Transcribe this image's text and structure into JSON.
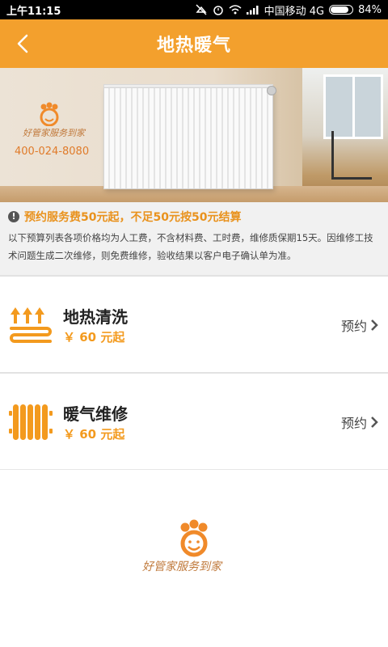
{
  "status_bar": {
    "time": "上午11:15",
    "carrier": "中国移动 4G",
    "battery": "84%",
    "battery_level": 0.84
  },
  "header": {
    "title": "地热暖气",
    "back_icon": "chevron-left-icon"
  },
  "banner": {
    "brand": "好管家服务到家",
    "phone": "400-024-8080"
  },
  "notice": {
    "headline": "预约服务费50元起，不足50元按50元结算",
    "description": "以下预算列表各项价格均为人工费，不含材料费、工时费，维修质保期15天。因维修工技术问题生成二次维修，则免费维修，验收结果以客户电子确认单为准。"
  },
  "services": [
    {
      "name": "地热清洗",
      "price": "￥ 60 元起",
      "action": "预约",
      "icon": "floor-heating-icon"
    },
    {
      "name": "暖气维修",
      "price": "￥ 60 元起",
      "action": "预约",
      "icon": "radiator-icon"
    }
  ],
  "footer": {
    "brand": "好管家服务到家"
  },
  "colors": {
    "accent": "#f3a02d",
    "price": "#f39a1e"
  }
}
